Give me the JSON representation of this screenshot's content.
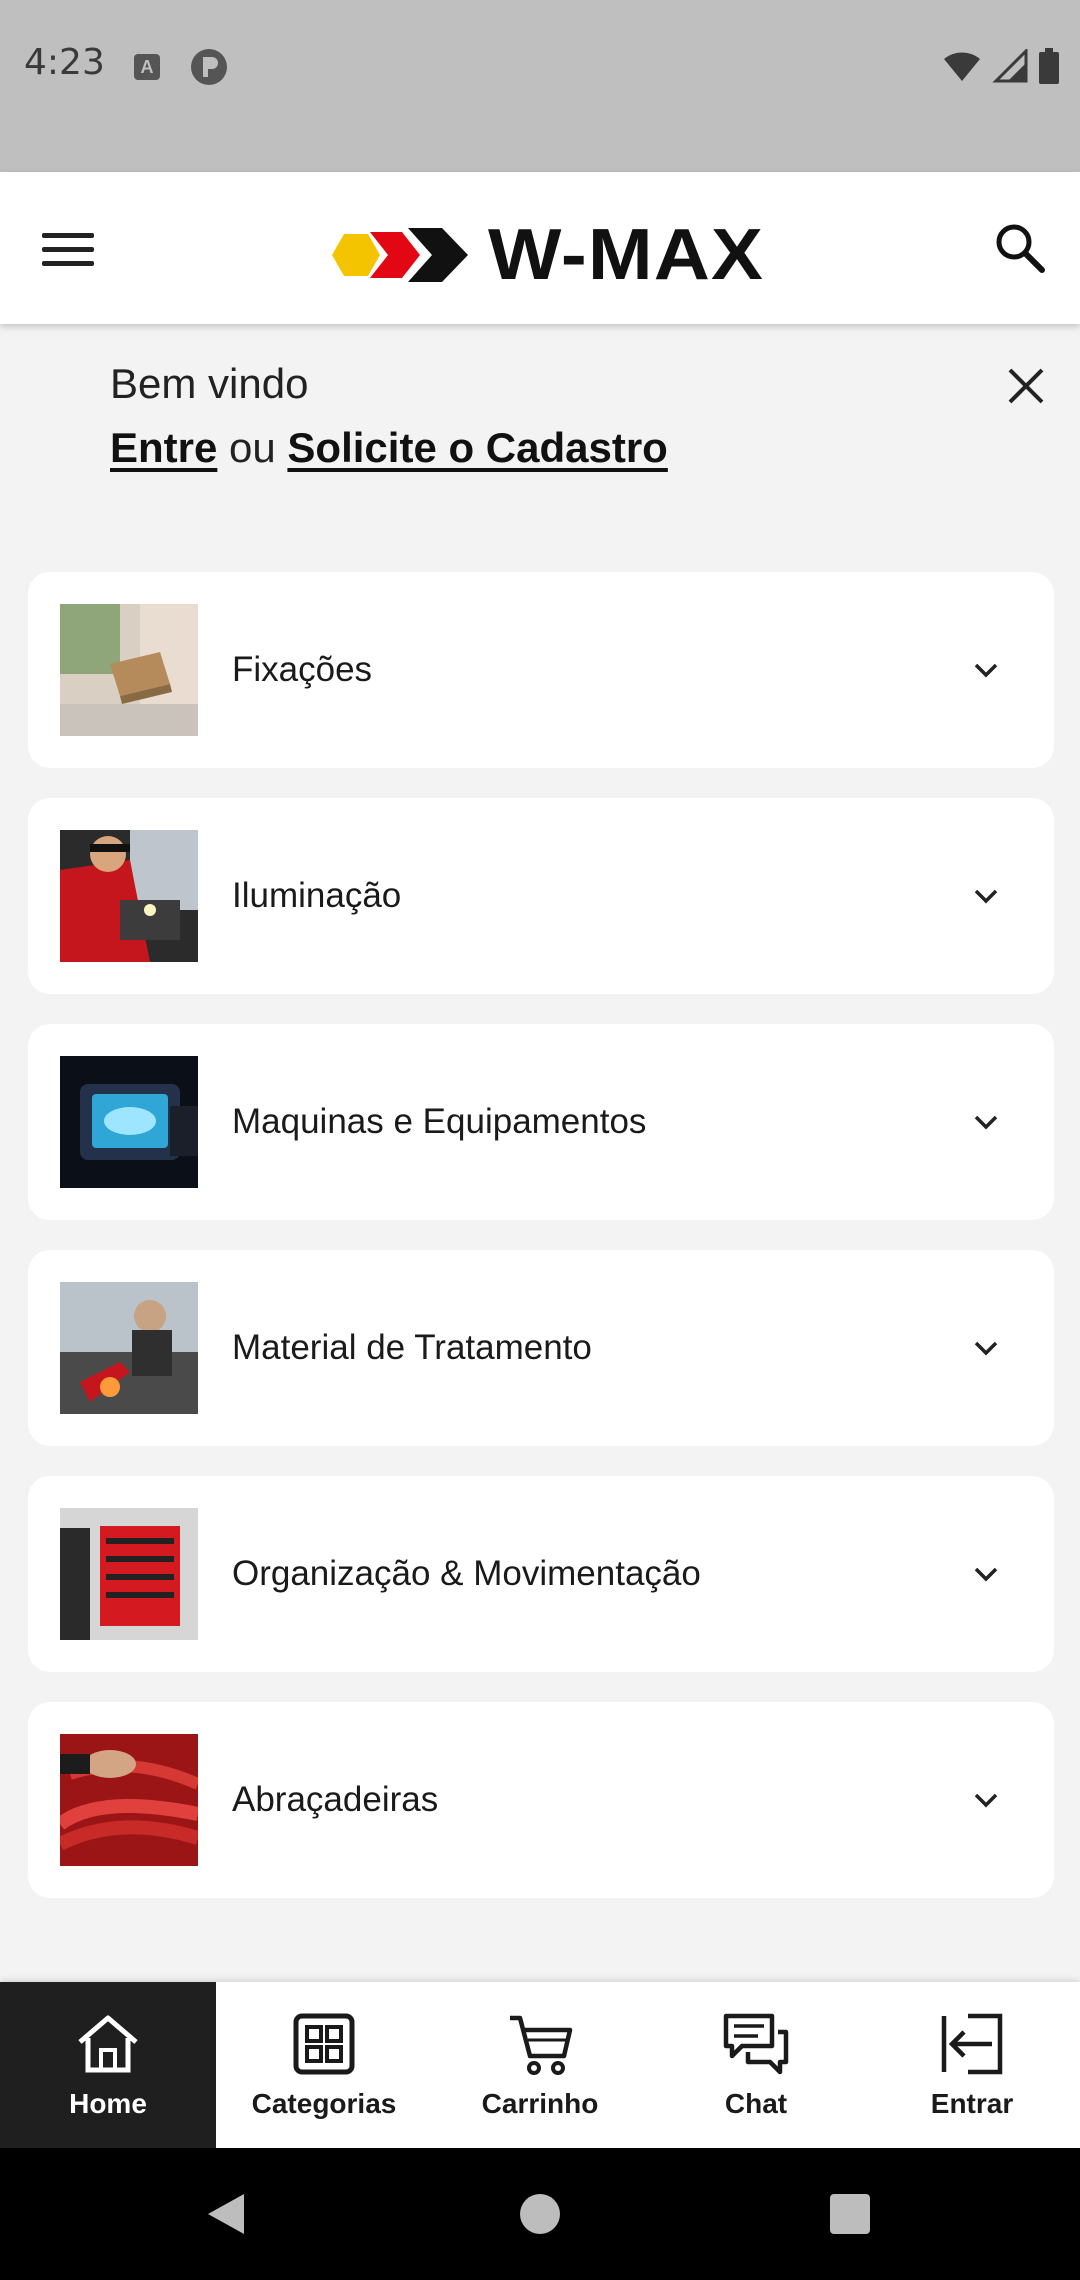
{
  "status_bar": {
    "time": "4:23",
    "icons": [
      "a-icon",
      "p-icon",
      "wifi-icon",
      "signal-icon",
      "battery-icon"
    ]
  },
  "header": {
    "brand": "W-MAX",
    "icons": [
      "menu-icon",
      "search-icon"
    ],
    "logo_colors": [
      "#f5c400",
      "#e30613",
      "#111111"
    ]
  },
  "welcome": {
    "title": "Bem vindo",
    "login_link": "Entre",
    "separator": "ou",
    "register_link": "Solicite o Cadastro"
  },
  "categories": [
    {
      "label": "Fixações",
      "icon": "chevron-down-icon"
    },
    {
      "label": "Iluminação",
      "icon": "chevron-down-icon"
    },
    {
      "label": "Maquinas e Equipamentos",
      "icon": "chevron-down-icon"
    },
    {
      "label": "Material de Tratamento",
      "icon": "chevron-down-icon"
    },
    {
      "label": "Organização & Movimentação",
      "icon": "chevron-down-icon"
    },
    {
      "label": "Abraçadeiras",
      "icon": "chevron-down-icon"
    }
  ],
  "bottom_nav": {
    "items": [
      {
        "label": "Home",
        "icon": "home-icon",
        "active": true
      },
      {
        "label": "Categorias",
        "icon": "grid-icon",
        "active": false
      },
      {
        "label": "Carrinho",
        "icon": "cart-icon",
        "active": false
      },
      {
        "label": "Chat",
        "icon": "chat-icon",
        "active": false
      },
      {
        "label": "Entrar",
        "icon": "login-icon",
        "active": false
      }
    ]
  },
  "colors": {
    "accent_dark": "#1f1f1f",
    "background": "#f3f3f3",
    "card": "#ffffff"
  }
}
